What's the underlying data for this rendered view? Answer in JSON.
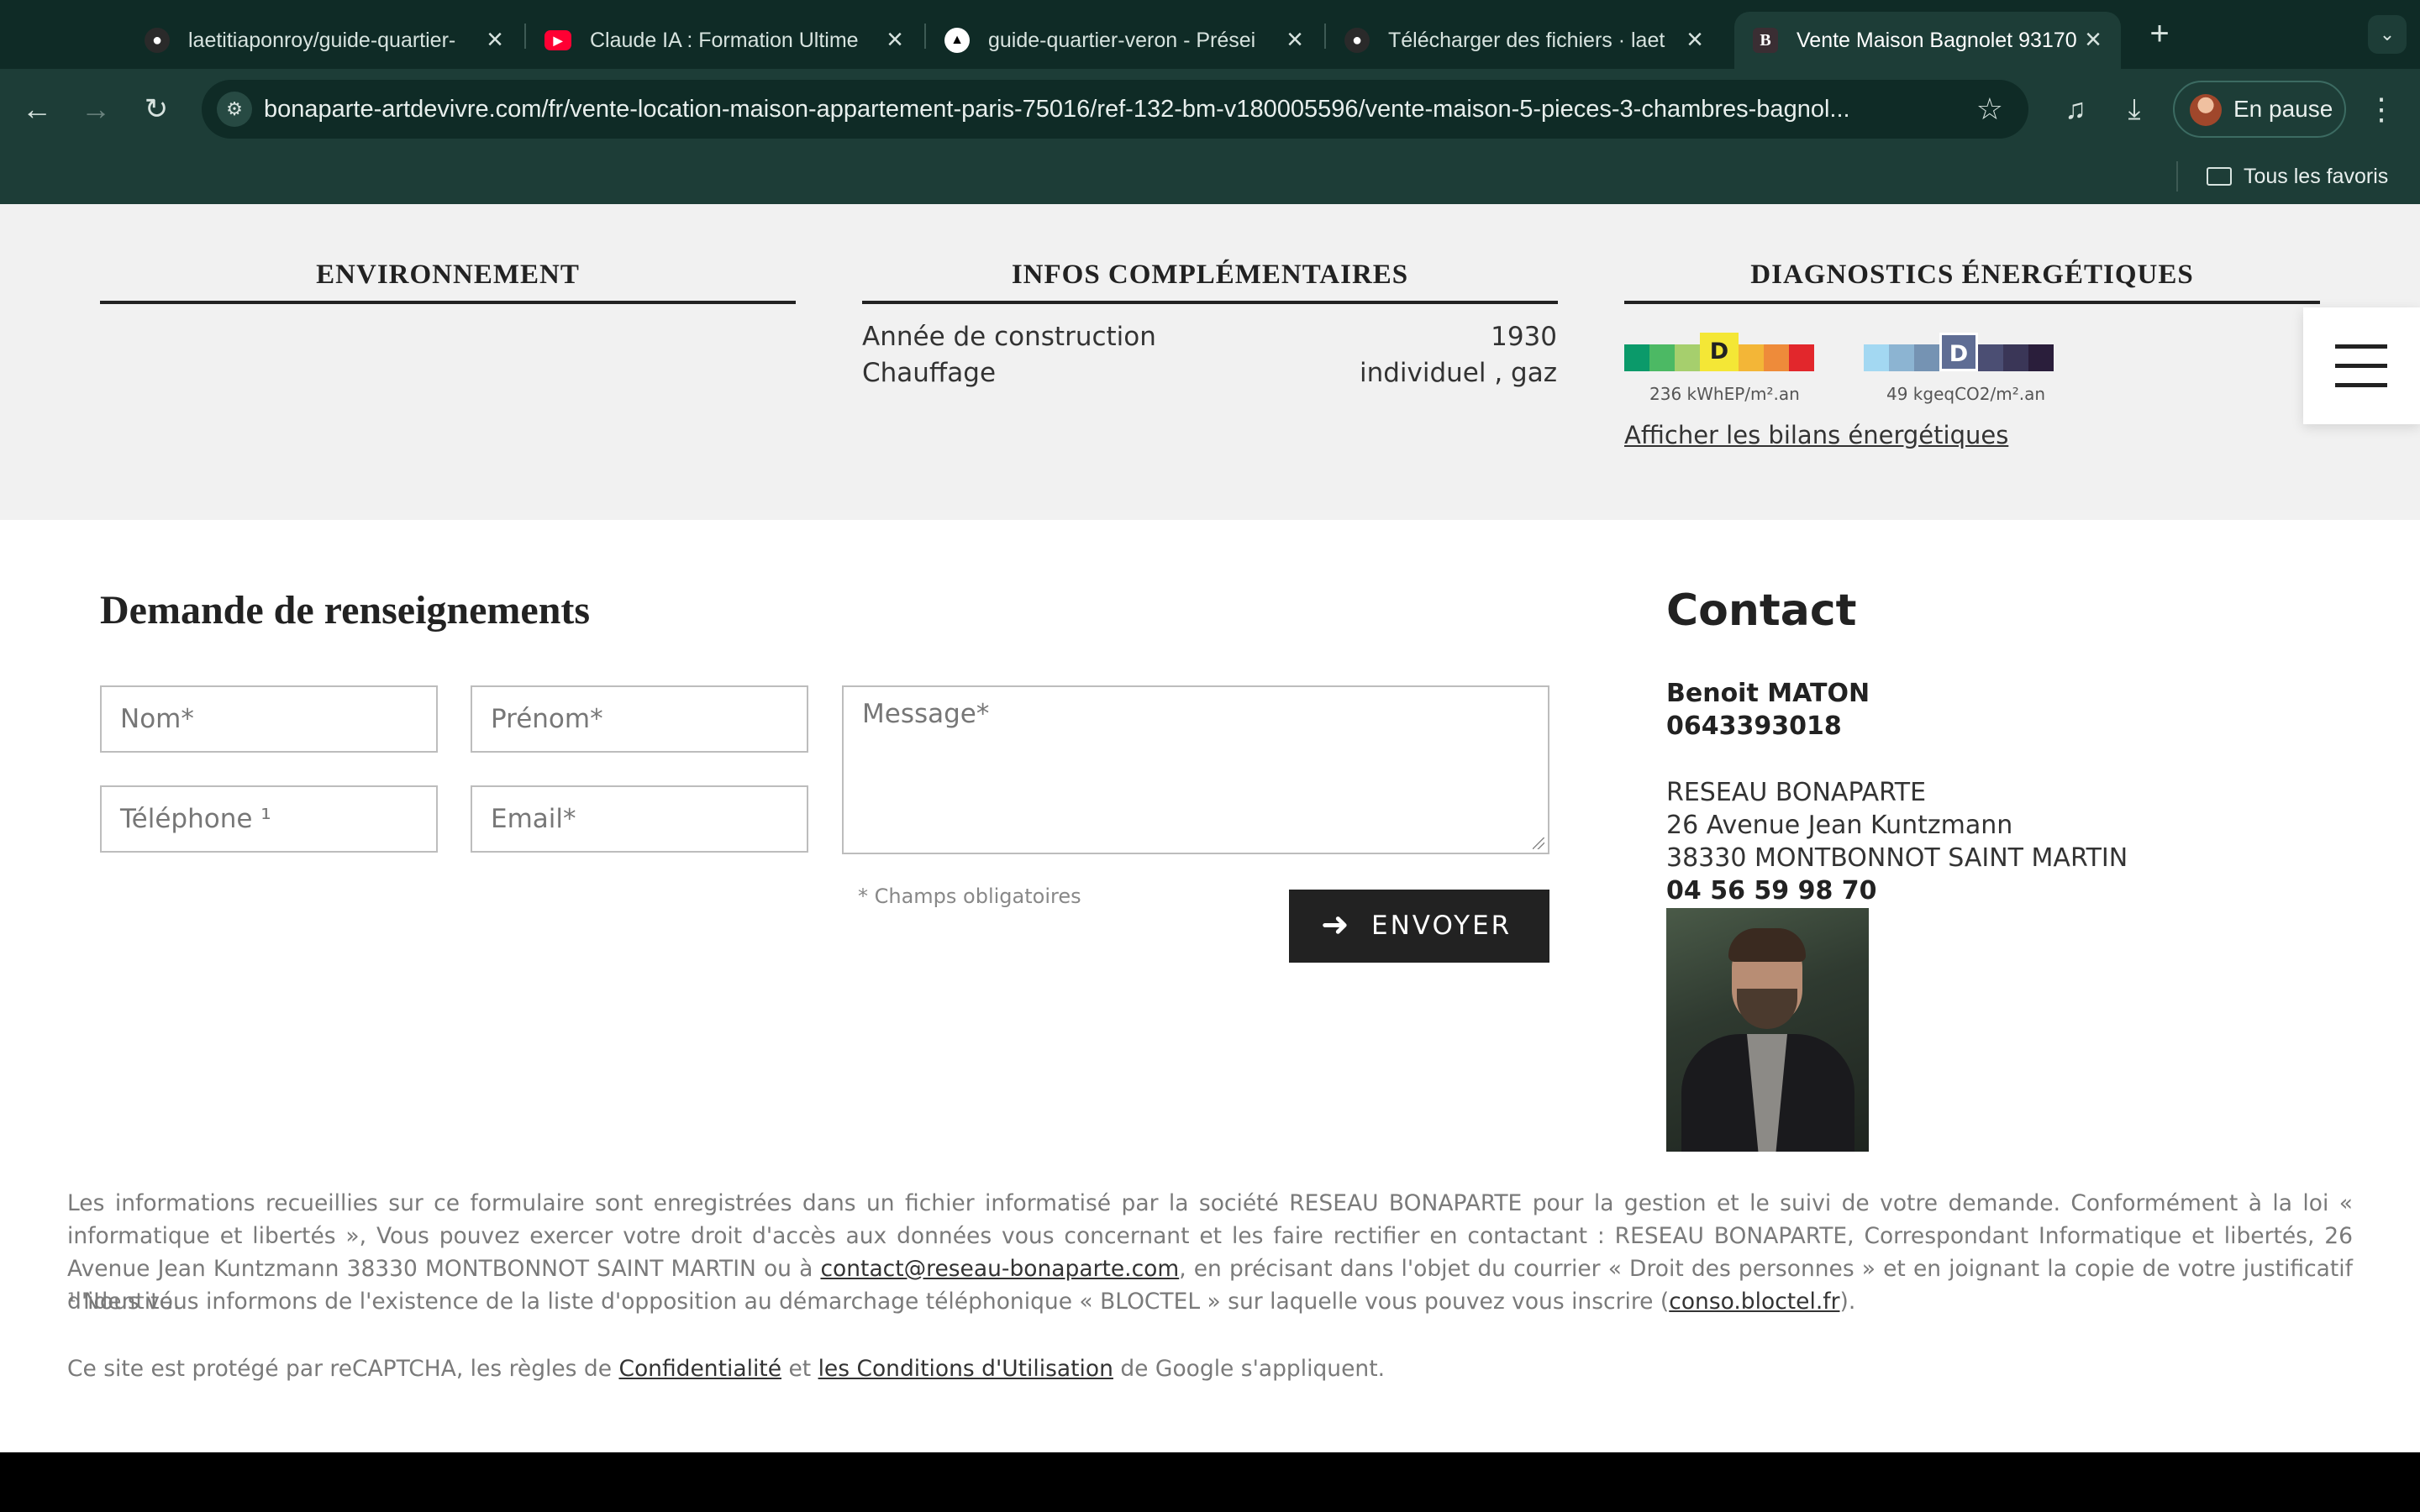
{
  "browser": {
    "tabs": [
      {
        "title": "laetitiaponroy/guide-quartier-",
        "icon": "github-icon"
      },
      {
        "title": "Claude IA : Formation Ultime ",
        "icon": "youtube-icon"
      },
      {
        "title": "guide-quartier-veron - Prései",
        "icon": "vercel-icon"
      },
      {
        "title": "Télécharger des fichiers · laet",
        "icon": "github-icon"
      },
      {
        "title": "Vente Maison Bagnolet 93170",
        "icon": "bonaparte-icon",
        "active": true
      }
    ],
    "url": "bonaparte-artdevivre.com/fr/vente-location-maison-appartement-paris-75016/ref-132-bm-v180005596/vente-maison-5-pieces-3-chambres-bagnol...",
    "profile_label": "En pause",
    "bookmarks_all": "Tous les favoris"
  },
  "sections": {
    "environment_title": "ENVIRONNEMENT",
    "infos_title": "INFOS COMPLÉMENTAIRES",
    "diagnostics_title": "DIAGNOSTICS ÉNERGÉTIQUES"
  },
  "infos": [
    {
      "label": "Année de construction",
      "value": "1930"
    },
    {
      "label": "Chauffage",
      "value": "individuel , gaz"
    }
  ],
  "diagnostics": {
    "dpe": {
      "grade": "D",
      "value_text": "236 kWhEP/m².an",
      "colors": [
        "#0b9a6a",
        "#4cb964",
        "#a6cf6d",
        "#f4e736",
        "#f3b637",
        "#ee8b3a",
        "#e2272c"
      ]
    },
    "ges": {
      "grade": "D",
      "value_text": "49 kgeqCO2/m².an",
      "colors": [
        "#a3d8f2",
        "#8cb4d2",
        "#7593b3",
        "#5f6d94",
        "#4b4e73",
        "#3a3657",
        "#2a1e3b"
      ]
    },
    "link": "Afficher les bilans énergétiques"
  },
  "form": {
    "title": "Demande de renseignements",
    "nom_placeholder": "Nom*",
    "prenom_placeholder": "Prénom*",
    "telephone_placeholder": "Téléphone ¹",
    "email_placeholder": "Email*",
    "message_placeholder": "Message*",
    "required_note": "* Champs obligatoires",
    "submit_label": "ENVOYER"
  },
  "contact": {
    "title": "Contact",
    "agent_name": "Benoit MATON",
    "agent_phone": "0643393018",
    "company": "RESEAU BONAPARTE",
    "address_line1": "26 Avenue Jean Kuntzmann",
    "address_line2": "38330 MONTBONNOT SAINT MARTIN",
    "company_phone": "04 56 59 98 70"
  },
  "legal": {
    "p1_a": "Les informations recueillies sur ce formulaire sont enregistrées dans un fichier informatisé par la société RESEAU BONAPARTE pour la gestion et le suivi de votre demande. Conformément à la loi « informatique et libertés », Vous pouvez exercer votre droit d'accès aux données vous concernant et les faire rectifier en contactant : RESEAU BONAPARTE, Correspondant Informatique et libertés, 26 Avenue Jean Kuntzmann 38330 MONTBONNOT SAINT MARTIN ou à ",
    "p1_email": "contact@reseau-bonaparte.com",
    "p1_b": ", en précisant dans l'objet du courrier « Droit des personnes » et en joignant la copie de votre justificatif d'identité.",
    "p2_a": "¹ Nous vous informons de l'existence de la liste d'opposition au démarchage téléphonique « BLOCTEL » sur laquelle vous pouvez vous inscrire (",
    "p2_link": "conso.bloctel.fr",
    "p2_b": ").",
    "p3_a": "Ce site est protégé par reCAPTCHA, les règles de ",
    "p3_link1": "Confidentialité",
    "p3_mid": " et ",
    "p3_link2": "les Conditions d'Utilisation",
    "p3_b": " de Google s'appliquent."
  }
}
